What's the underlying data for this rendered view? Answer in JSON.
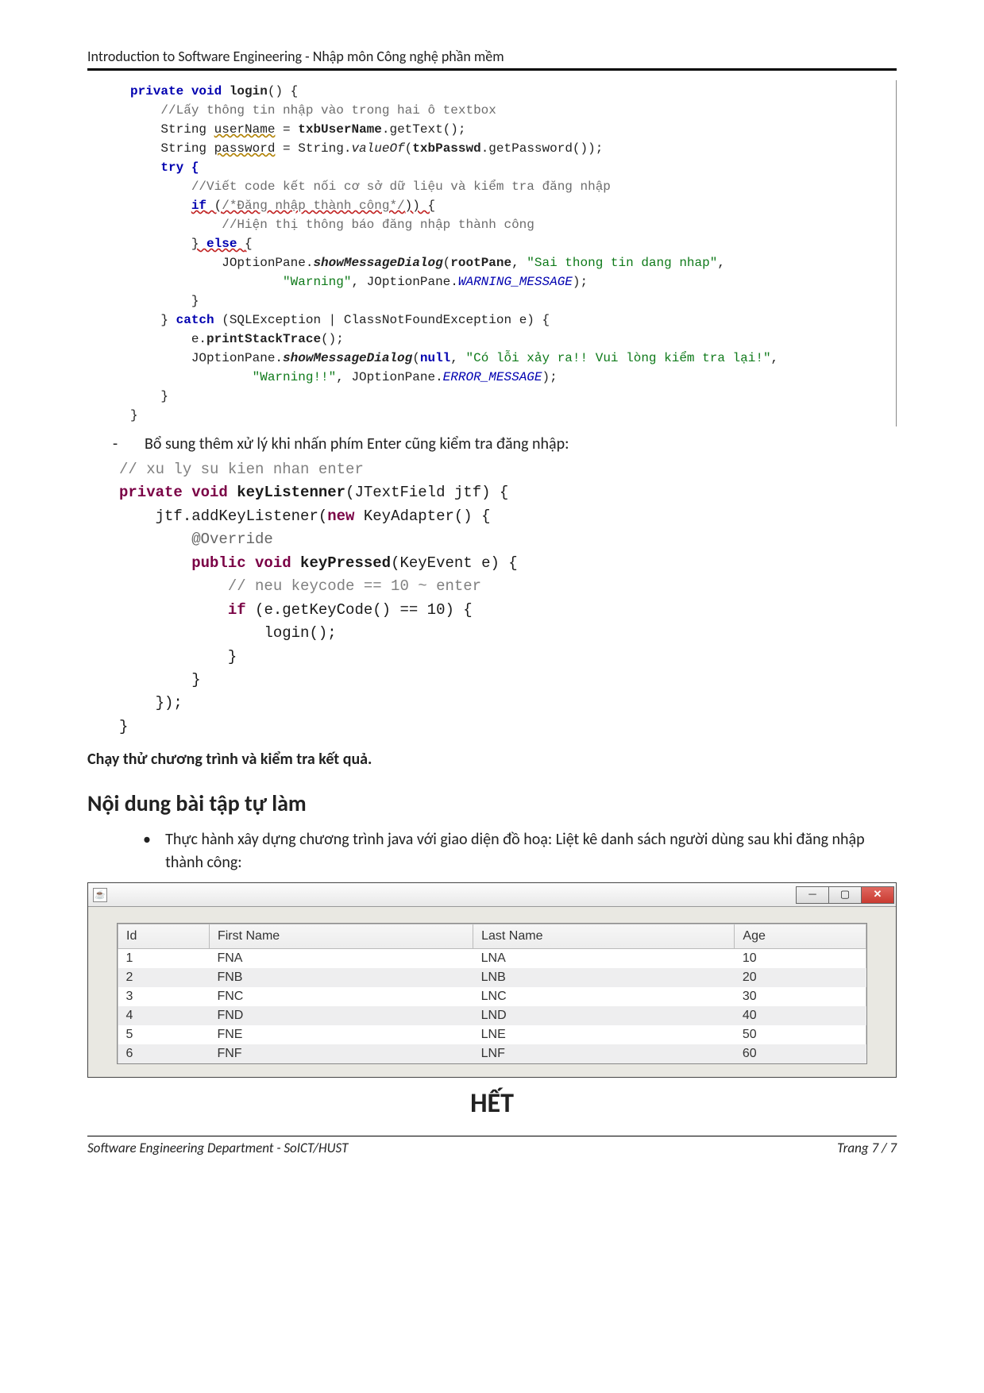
{
  "header": "Introduction to Software Engineering - Nhập môn Công nghệ phần mềm",
  "bullet1": "Bổ sung thêm xử lý khi nhấn phím Enter cũng kiểm tra đăng nhập:",
  "code1": {
    "l01a": "private void ",
    "l01b": "login",
    "l01c": "() {",
    "l02": "//Lấy thông tin nhập vào trong hai ô textbox",
    "l03a": "String ",
    "l03b": "userName",
    "l03c": " = ",
    "l03d": "txbUserName",
    "l03e": ".getText();",
    "l04a": "String ",
    "l04b": "password",
    "l04c": " = String.",
    "l04d": "valueOf",
    "l04e": "(",
    "l04f": "txbPasswd",
    "l04g": ".getPassword());",
    "l05": "try {",
    "l06": "//Viết code kết nối cơ sở dữ liệu và kiểm tra đăng nhập",
    "l07a": "if",
    "l07b": " (",
    "l07c": "/*Đăng nhập thành công*/",
    "l07d": ")) {",
    "l08": "//Hiện thị thông báo đăng nhập thành công",
    "l09a": "}",
    "l09b": " else ",
    "l09c": "{",
    "l10a": "JOptionPane.",
    "l10b": "showMessageDialog",
    "l10c": "(",
    "l10d": "rootPane",
    "l10e": ", ",
    "l10f": "\"Sai thong tin dang nhap\"",
    "l10g": ",",
    "l11a": "\"Warning\"",
    "l11b": ", JOptionPane.",
    "l11c": "WARNING_MESSAGE",
    "l11d": ");",
    "l12": "}",
    "l13a": "} ",
    "l13b": "catch",
    "l13c": " (SQLException | ClassNotFoundException e) {",
    "l14a": "e.",
    "l14b": "printStackTrace",
    "l14c": "();",
    "l15a": "JOptionPane.",
    "l15b": "showMessageDialog",
    "l15c": "(",
    "l15d": "null",
    "l15e": ", ",
    "l15f": "\"Có lỗi xảy ra!! Vui lòng kiểm tra lại!\"",
    "l15g": ",",
    "l16a": "\"Warning!!\"",
    "l16b": ", JOptionPane.",
    "l16c": "ERROR_MESSAGE",
    "l16d": ");",
    "l17": "}",
    "l18": "}"
  },
  "code2": {
    "l01": "// xu ly su kien nhan enter",
    "l02a": "private void ",
    "l02b": "keyListenner",
    "l02c": "(JTextField jtf) {",
    "l03a": "jtf.addKeyListener(",
    "l03b": "new",
    "l03c": " KeyAdapter() {",
    "l04": "@Override",
    "l05a": "public void ",
    "l05b": "keyPressed",
    "l05c": "(KeyEvent e) {",
    "l06": "// neu keycode == 10 ~ enter",
    "l07a": "if",
    "l07b": " (e.getKeyCode() == 10) {",
    "l08": "login();",
    "l09": "}",
    "l10": "}",
    "l11": "});",
    "l12": "}"
  },
  "run_line": "Chạy thử chương trình và kiểm tra kết quả.",
  "section_title": "Nội dung bài tập tự làm",
  "li_text": "Thực hành xây dựng chương trình java với giao diện đồ hoạ: Liệt kê danh sách người dùng sau khi đăng nhập thành công:",
  "table": {
    "headers": [
      "Id",
      "First Name",
      "Last Name",
      "Age"
    ],
    "rows": [
      [
        "1",
        "FNA",
        "LNA",
        "10"
      ],
      [
        "2",
        "FNB",
        "LNB",
        "20"
      ],
      [
        "3",
        "FNC",
        "LNC",
        "30"
      ],
      [
        "4",
        "FND",
        "LND",
        "40"
      ],
      [
        "5",
        "FNE",
        "LNE",
        "50"
      ],
      [
        "6",
        "FNF",
        "LNF",
        "60"
      ]
    ]
  },
  "java_icon_glyph": "☕",
  "win_min": "—",
  "win_max": "▢",
  "win_close": "✕",
  "end": "HẾT",
  "footer_left": "Software Engineering Department - SoICT/HUST",
  "footer_right": "Trang 7 / 7"
}
